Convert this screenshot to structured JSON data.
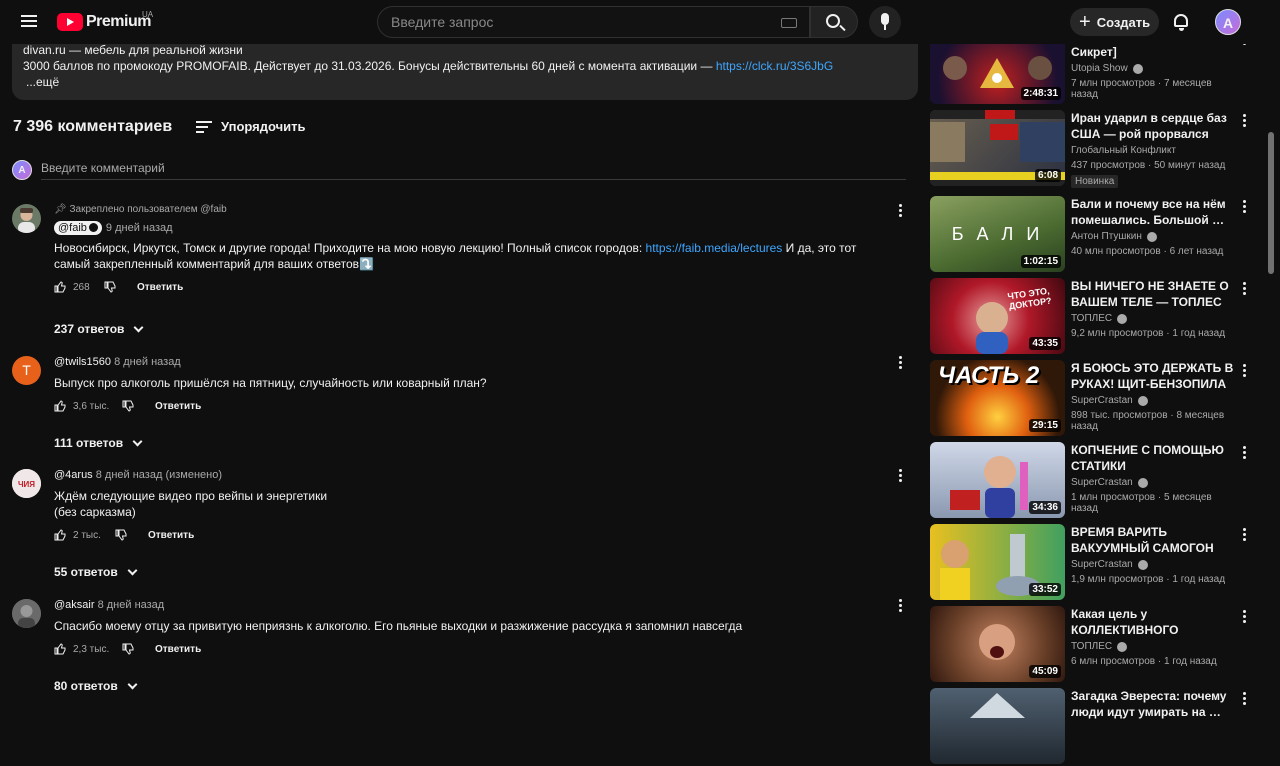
{
  "topbar": {
    "logo_text": "Premium",
    "country_code": "UA",
    "search_placeholder": "Введите запрос",
    "create_label": "Создать",
    "avatar_letter": "A"
  },
  "description": {
    "line1": "divan.ru — мебель для реальной жизни",
    "line2_prefix": "3000 баллов по промокоду PROMOFAIB. Действует до 31.03.2026. Бонусы действительны 60 дней с момента активации — ",
    "line2_link": "https://clck.ru/3S6JbG",
    "more": "...ещё"
  },
  "comments_header": {
    "count_label": "7 396 комментариев",
    "sort_label": "Упорядочить",
    "add_placeholder": "Введите комментарий"
  },
  "comments": [
    {
      "pinned_by": "Закреплено пользователем @faib",
      "author": "@faib",
      "time": "9 дней назад",
      "text_prefix": "Новосибирск, Иркутск, Томск и другие города! Приходите на мою новую лекцию! Полный список городов: ",
      "link": "https://faib.media/lectures",
      "text_suffix": " И да, это тот самый закрепленный комментарий для ваших ответов⤵️",
      "likes": "268",
      "reply_label": "Ответить",
      "replies_label": "237 ответов"
    },
    {
      "author": "@twils1560",
      "time": "8 дней назад",
      "text": "Выпуск про алкоголь пришёлся на пятницу, случайность или коварный план?",
      "likes": "3,6 тыс.",
      "reply_label": "Ответить",
      "replies_label": "111 ответов",
      "avatar_letter": "T"
    },
    {
      "author": "@4arus",
      "time": "8 дней назад (изменено)",
      "text_line1": "Ждём следующие видео про вейпы и энергетики",
      "text_line2": "(без сарказма)",
      "likes": "2 тыс.",
      "reply_label": "Ответить",
      "replies_label": "55 ответов"
    },
    {
      "author": "@aksair",
      "time": "8 дней назад",
      "text": "Спасибо моему отцу за привитую неприязнь к алкоголю. Его пьяные выходки и разжижение рассудка я запомнил навсегда",
      "likes": "2,3 тыс.",
      "reply_label": "Ответить",
      "replies_label": "80 ответов"
    }
  ],
  "sidebar": [
    {
      "title": "ПРАВИТЕЛЬСТВО [Топ Сикрет]",
      "channel": "Utopia Show",
      "views": "7 млн просмотров",
      "age": "7 месяцев назад",
      "duration": "2:48:31"
    },
    {
      "title": "Иран ударил в сердце баз США — рой прорвался сквоз…",
      "channel": "Глобальный Конфликт",
      "views": "437 просмотров",
      "age": "50 минут назад",
      "duration": "6:08",
      "badge": "Новинка"
    },
    {
      "title": "Бали и почему все на нём помешались. Большой …",
      "channel": "Антон Птушкин",
      "views": "40 млн просмотров",
      "age": "6 лет назад",
      "duration": "1:02:15",
      "thumb_text": "Б А Л И"
    },
    {
      "title": "ВЫ НИЧЕГО НЕ ЗНАЕТЕ О ВАШЕМ ТЕЛЕ — ТОПЛЕС",
      "channel": "ТОПЛЕС",
      "views": "9,2 млн просмотров",
      "age": "1 год назад",
      "duration": "43:35",
      "thumb_text": "ЧТО ЭТО, ДОКТОР?"
    },
    {
      "title": "Я БОЮСЬ ЭТО ДЕРЖАТЬ В РУКАХ! ЩИТ-БЕНЗОПИЛА И…",
      "channel": "SuperCrastan",
      "views": "898 тыс. просмотров",
      "age": "8 месяцев назад",
      "duration": "29:15",
      "thumb_text": "ЧАСТЬ 2"
    },
    {
      "title": "КОПЧЕНИЕ С ПОМОЩЬЮ СТАТИКИ",
      "channel": "SuperCrastan",
      "views": "1 млн просмотров",
      "age": "5 месяцев назад",
      "duration": "34:36"
    },
    {
      "title": "ВРЕМЯ ВАРИТЬ ВАКУУМНЫЙ САМОГОН",
      "channel": "SuperCrastan",
      "views": "1,9 млн просмотров",
      "age": "1 год назад",
      "duration": "33:52"
    },
    {
      "title": "Какая цель у КОЛЛЕКТИВНОГО СОЗНАНИ…",
      "channel": "ТОПЛЕС",
      "views": "6 млн просмотров",
      "age": "1 год назад",
      "duration": "45:09"
    },
    {
      "title": "Загадка Эвереста: почему люди идут умирать на …",
      "channel": "",
      "views": "",
      "age": "",
      "duration": ""
    }
  ],
  "colors": {
    "background": "#0f0f0f",
    "link": "#3ea6ff",
    "brand_red": "#ff0033",
    "muted_text": "#aaaaaa"
  }
}
